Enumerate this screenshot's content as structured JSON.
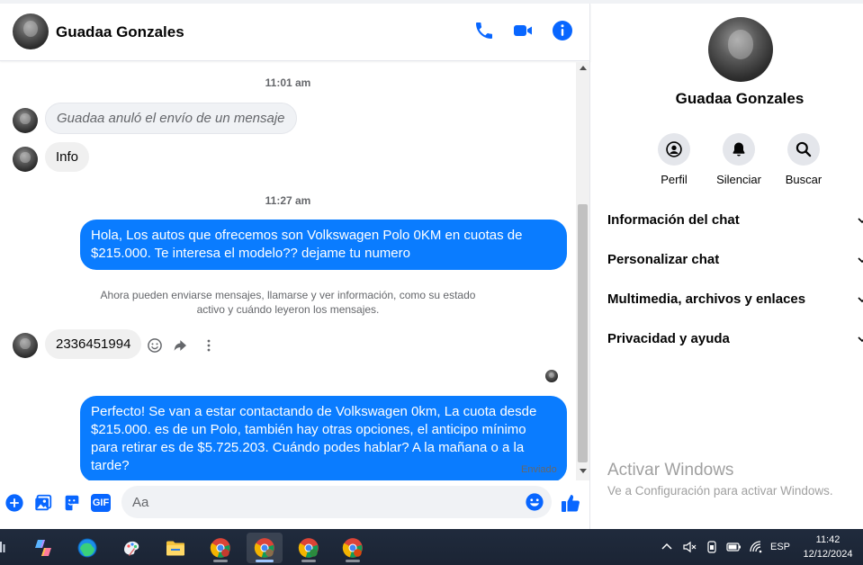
{
  "contact": {
    "name": "Guadaa Gonzales"
  },
  "header": {
    "icons": [
      "phone-icon",
      "video-camera-icon",
      "info-icon"
    ]
  },
  "messages": {
    "timestamp_1": "11:01 am",
    "unsent_notice": "Guadaa anuló el envío de un mensaje",
    "incoming_info": "Info",
    "timestamp_2": "11:27 am",
    "outgoing_1": "Hola, Los autos que ofrecemos son Volkswagen Polo 0KM en cuotas de $215.000. Te interesa el modelo?? dejame tu numero",
    "system_notice": "Ahora pueden enviarse mensajes, llamarse y ver información, como su estado activo y cuándo leyeron los mensajes.",
    "incoming_phone": "2336451994",
    "outgoing_2": "Perfecto!  Se van a estar contactando de Volkswagen 0km, La cuota desde $215.000. es de un Polo, también hay otras opciones, el anticipo mínimo para retirar es de $5.725.203. Cuándo podes hablar? A la mañana o a la tarde?",
    "sent_status": "Enviado"
  },
  "composer": {
    "placeholder": "Aa",
    "icons": [
      "plus-circle-icon",
      "image-icon",
      "sticker-icon",
      "gif-icon",
      "emoji-icon",
      "thumbs-up-icon"
    ],
    "gif_label": "GIF"
  },
  "side_panel": {
    "name": "Guadaa Gonzales",
    "actions": [
      {
        "label": "Perfil",
        "icon": "profile-icon"
      },
      {
        "label": "Silenciar",
        "icon": "bell-icon"
      },
      {
        "label": "Buscar",
        "icon": "search-icon"
      }
    ],
    "sections": [
      "Información del chat",
      "Personalizar chat",
      "Multimedia, archivos y enlaces",
      "Privacidad y ayuda"
    ]
  },
  "watermark": {
    "title": "Activar Windows",
    "subtitle": "Ve a Configuración para activar Windows."
  },
  "taskbar": {
    "language": "ESP",
    "time": "11:42",
    "date": "12/12/2024"
  },
  "colors": {
    "accent": "#0a7cff",
    "messenger_icon": "#0866ff",
    "incoming_bubble": "#f0f0f0",
    "taskbar": "#1c2638"
  }
}
